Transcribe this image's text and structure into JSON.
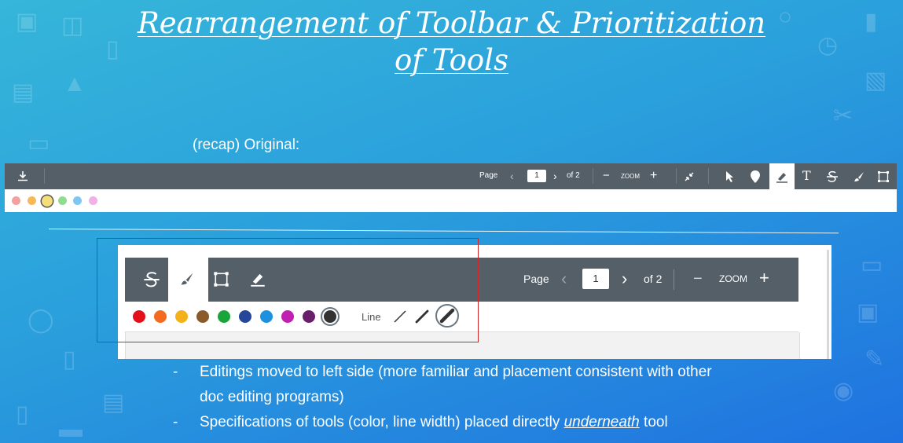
{
  "slide": {
    "title_line1": "Rearrangement of Toolbar & Prioritization",
    "title_line2": "of Tools",
    "recap_label": "(recap) Original:"
  },
  "original_toolbar": {
    "page_label": "Page",
    "page_value": "1",
    "of_label": "of 2",
    "zoom_label": "ZOOM",
    "colors": [
      "#f2a0a0",
      "#f7b85a",
      "#f3de7a",
      "#8fdc8f",
      "#7ec8f0",
      "#f0b0e8"
    ],
    "selected_color_index": 2
  },
  "new_toolbar": {
    "page_label": "Page",
    "page_value": "1",
    "of_label": "of 2",
    "zoom_label": "ZOOM",
    "line_label": "Line",
    "colors": [
      "#e3101a",
      "#f46a1f",
      "#f5b11a",
      "#8a5a2b",
      "#1aa53a",
      "#24479a",
      "#1e90e0",
      "#c11fb0",
      "#6a1f6a",
      "#333333"
    ],
    "selected_color_index": 9,
    "selected_line_width_index": 2
  },
  "bullets": [
    {
      "text_line1": "Editings moved to left side (more familiar and placement consistent with other",
      "text_line2": "doc editing programs)"
    },
    {
      "text_before": "Specifications of tools (color, line width) placed directly ",
      "text_emphasis": "underneath",
      "text_after": " tool"
    }
  ],
  "bullet_marker": "-",
  "theme": {
    "accent_red": "#d32525",
    "toolbar_gray": "#545f68"
  }
}
